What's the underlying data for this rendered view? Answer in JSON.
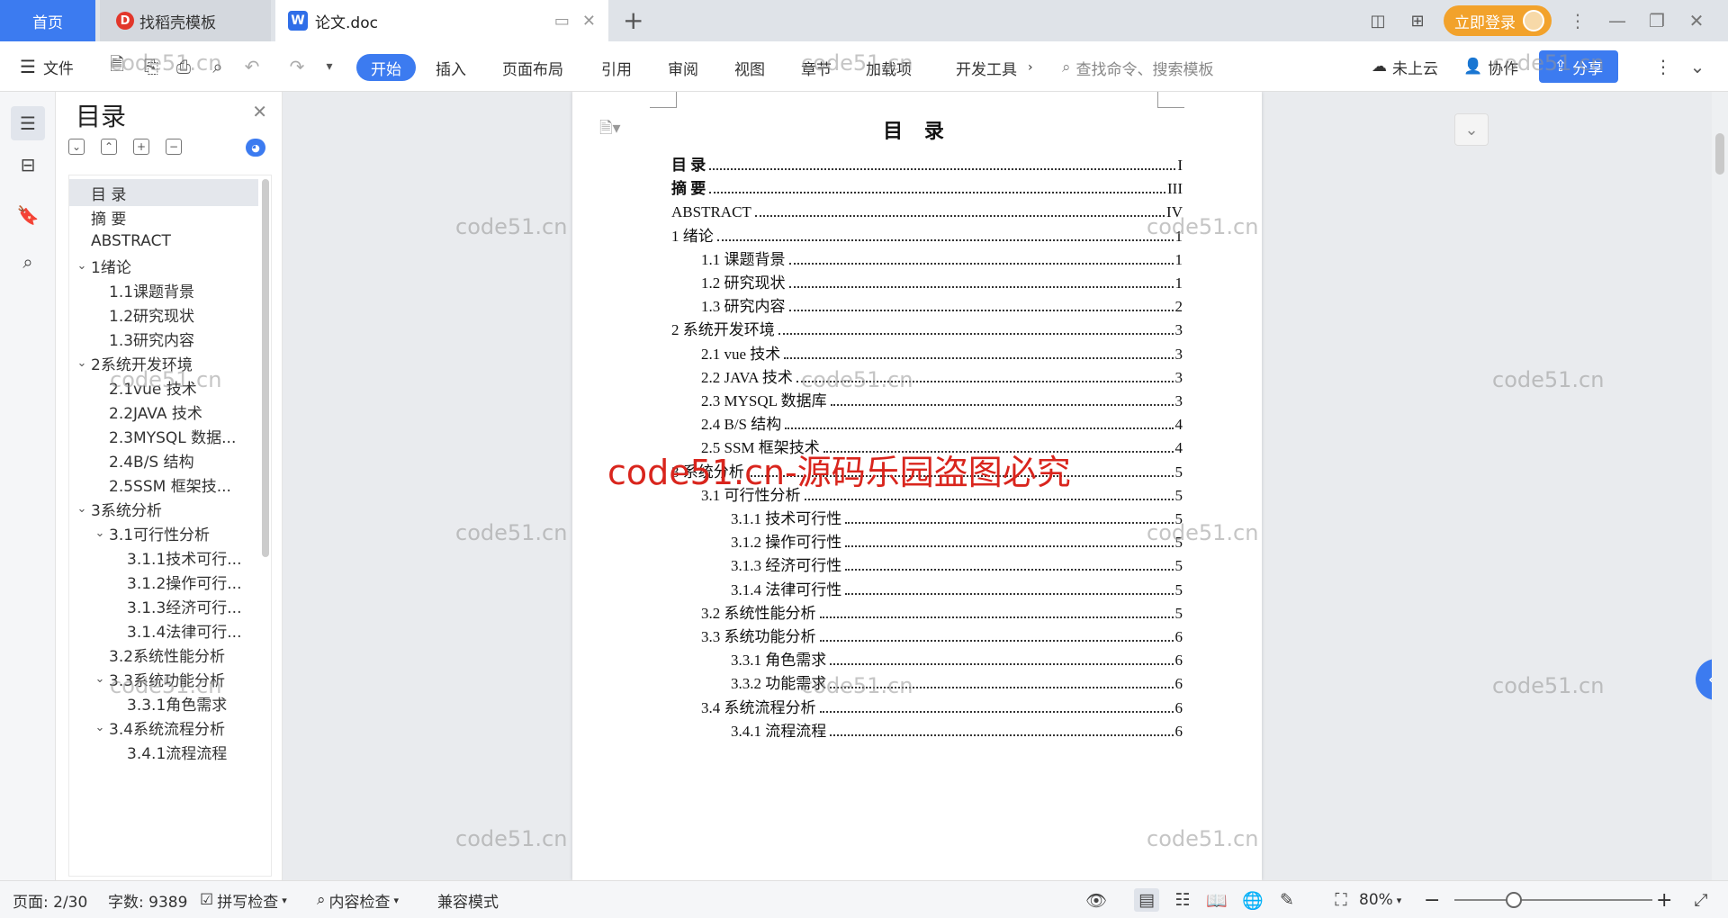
{
  "tabs": {
    "home": "首页",
    "templates": "找稻壳模板",
    "document": "论文.doc",
    "login": "立即登录"
  },
  "toolbar": {
    "file": "文件",
    "ribbon": [
      "开始",
      "插入",
      "页面布局",
      "引用",
      "审阅",
      "视图",
      "章节",
      "加载项",
      "开发工具"
    ],
    "more": "›",
    "search_placeholder": "查找命令、搜索模板",
    "cloud": "未上云",
    "collab": "协作",
    "share": "分享"
  },
  "toc_panel": {
    "title": "目录",
    "items": [
      {
        "label": "目  录",
        "level": 1,
        "chevron": false,
        "active": true
      },
      {
        "label": "摘   要",
        "level": 1,
        "chevron": false
      },
      {
        "label": "ABSTRACT",
        "level": 1,
        "chevron": false
      },
      {
        "label": "1绪论",
        "level": 1,
        "chevron": true
      },
      {
        "label": "1.1课题背景",
        "level": 2,
        "chevron": false
      },
      {
        "label": "1.2研究现状",
        "level": 2,
        "chevron": false
      },
      {
        "label": "1.3研究内容",
        "level": 2,
        "chevron": false
      },
      {
        "label": "2系统开发环境",
        "level": 1,
        "chevron": true
      },
      {
        "label": "2.1vue 技术",
        "level": 2,
        "chevron": false
      },
      {
        "label": "2.2JAVA 技术",
        "level": 2,
        "chevron": false
      },
      {
        "label": "2.3MYSQL 数据...",
        "level": 2,
        "chevron": false
      },
      {
        "label": "2.4B/S 结构",
        "level": 2,
        "chevron": false
      },
      {
        "label": "2.5SSM 框架技...",
        "level": 2,
        "chevron": false
      },
      {
        "label": "3系统分析",
        "level": 1,
        "chevron": true
      },
      {
        "label": "3.1可行性分析",
        "level": 2,
        "chevron": true
      },
      {
        "label": "3.1.1技术可行...",
        "level": 3,
        "chevron": false
      },
      {
        "label": "3.1.2操作可行...",
        "level": 3,
        "chevron": false
      },
      {
        "label": "3.1.3经济可行...",
        "level": 3,
        "chevron": false
      },
      {
        "label": "3.1.4法律可行...",
        "level": 3,
        "chevron": false
      },
      {
        "label": "3.2系统性能分析",
        "level": 2,
        "chevron": false
      },
      {
        "label": "3.3系统功能分析",
        "level": 2,
        "chevron": true
      },
      {
        "label": "3.3.1角色需求",
        "level": 3,
        "chevron": false
      },
      {
        "label": "3.4系统流程分析",
        "level": 2,
        "chevron": true
      },
      {
        "label": "3.4.1流程流程",
        "level": 3,
        "chevron": false
      }
    ]
  },
  "document": {
    "heading": "目 录",
    "entries": [
      {
        "text": "目  录",
        "page": "I",
        "indent": 0,
        "bold": true
      },
      {
        "text": "摘    要",
        "page": "III",
        "indent": 0,
        "bold": true
      },
      {
        "text": "ABSTRACT",
        "page": "IV",
        "indent": 0,
        "bold": false
      },
      {
        "text": "1  绪论",
        "page": "1",
        "indent": 0
      },
      {
        "text": "1.1  课题背景",
        "page": "1",
        "indent": 1
      },
      {
        "text": "1.2  研究现状",
        "page": "1",
        "indent": 1
      },
      {
        "text": "1.3  研究内容",
        "page": "2",
        "indent": 1
      },
      {
        "text": "2  系统开发环境",
        "page": "3",
        "indent": 0
      },
      {
        "text": "2.1 vue 技术",
        "page": "3",
        "indent": 1
      },
      {
        "text": "2.2 JAVA 技术",
        "page": "3",
        "indent": 1
      },
      {
        "text": "2.3 MYSQL 数据库",
        "page": "3",
        "indent": 1
      },
      {
        "text": "2.4 B/S 结构",
        "page": "4",
        "indent": 1
      },
      {
        "text": "2.5 SSM 框架技术",
        "page": "4",
        "indent": 1
      },
      {
        "text": "3  系统分析",
        "page": "5",
        "indent": 0
      },
      {
        "text": "3.1  可行性分析",
        "page": "5",
        "indent": 1
      },
      {
        "text": "3.1.1  技术可行性",
        "page": "5",
        "indent": 2
      },
      {
        "text": "3.1.2  操作可行性",
        "page": "5",
        "indent": 2
      },
      {
        "text": "3.1.3  经济可行性",
        "page": "5",
        "indent": 2
      },
      {
        "text": "3.1.4  法律可行性",
        "page": "5",
        "indent": 2
      },
      {
        "text": "3.2  系统性能分析",
        "page": "5",
        "indent": 1
      },
      {
        "text": "3.3  系统功能分析",
        "page": "6",
        "indent": 1
      },
      {
        "text": "3.3.1  角色需求",
        "page": "6",
        "indent": 2
      },
      {
        "text": "3.3.2  功能需求",
        "page": "6",
        "indent": 2
      },
      {
        "text": "3.4  系统流程分析",
        "page": "6",
        "indent": 1
      },
      {
        "text": "3.4.1  流程流程",
        "page": "6",
        "indent": 2
      }
    ]
  },
  "watermark": {
    "small": "code51.cn",
    "big": "code51.cn-源码乐园盗图必究"
  },
  "status_bar": {
    "page": "页面: 2/30",
    "words": "字数: 9389",
    "spell": "拼写检查",
    "content_check": "内容检查",
    "compat": "兼容模式",
    "zoom": "80%",
    "zoom_level": 0.3
  },
  "colors": {
    "accent": "#3c7bf0",
    "login": "#f2a22b",
    "watermark_red": "#d9251d"
  }
}
